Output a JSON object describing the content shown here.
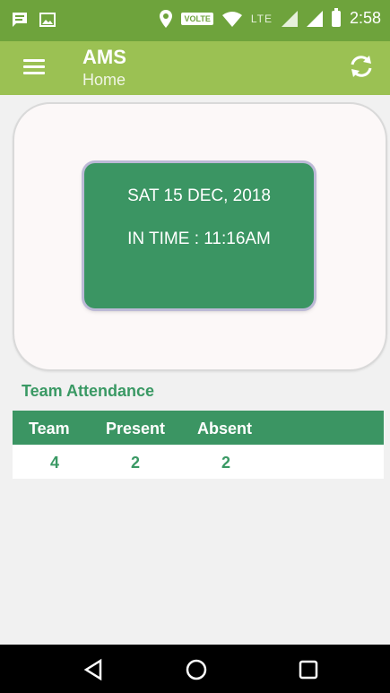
{
  "status_bar": {
    "time": "2:58",
    "network_badge": "VOLTE",
    "lte_label": "LTE",
    "icons": [
      "message-icon",
      "image-icon",
      "location-icon",
      "wifi-icon",
      "signal-icon",
      "battery-icon"
    ]
  },
  "app_bar": {
    "title": "AMS",
    "subtitle": "Home",
    "icons": [
      "menu-icon",
      "refresh-icon"
    ]
  },
  "attendance_card": {
    "date": "SAT 15 DEC, 2018",
    "in_time": "IN TIME : 11:16AM"
  },
  "team_attendance": {
    "title": "Team Attendance",
    "columns": [
      "Team",
      "Present",
      "Absent"
    ],
    "rows": [
      [
        "4",
        "2",
        "2"
      ]
    ]
  },
  "nav_bar": {
    "icons": [
      "back-icon",
      "home-icon",
      "recents-icon"
    ]
  },
  "colors": {
    "status_bar": "#6ea33c",
    "app_bar": "#9bc153",
    "accent_green": "#3b9563",
    "text_green": "#3a9964"
  }
}
